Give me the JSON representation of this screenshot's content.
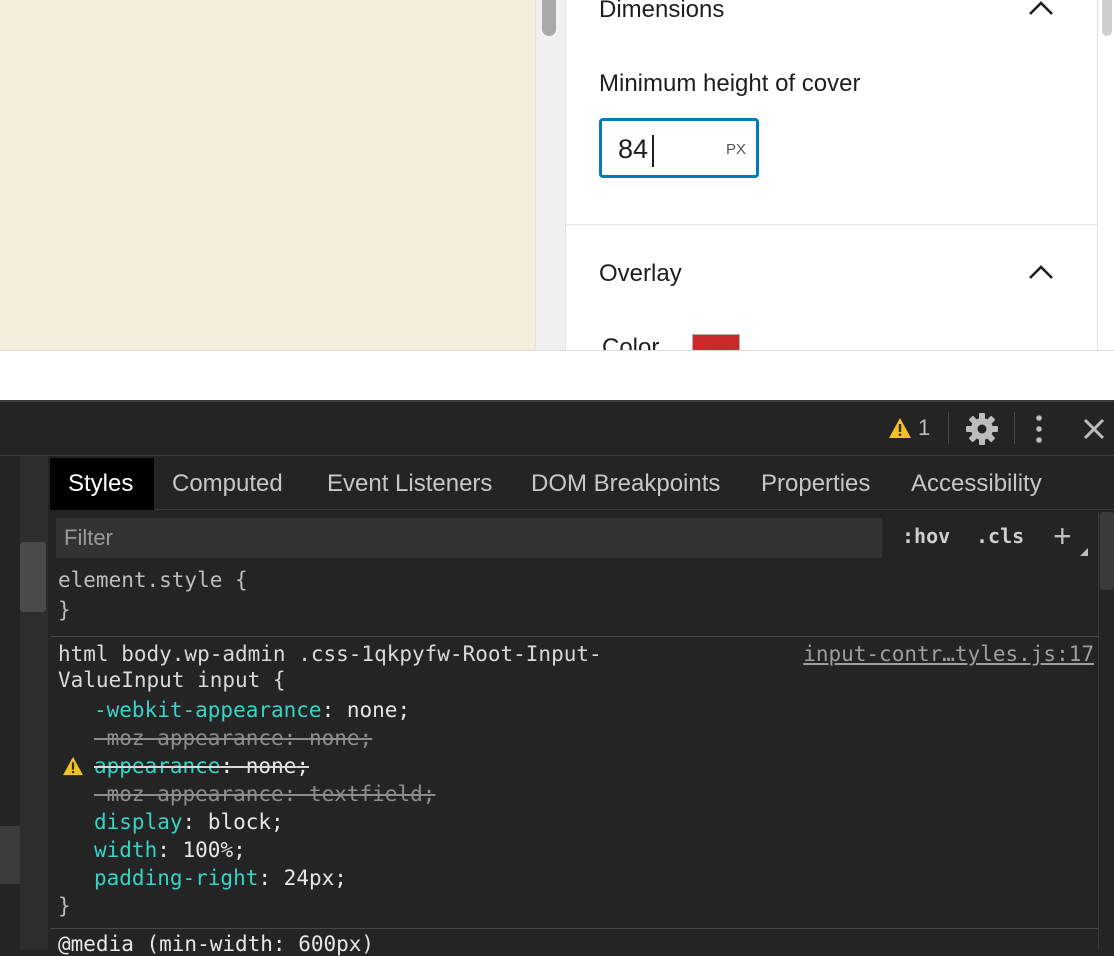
{
  "sidebar_panel": {
    "dimensions": {
      "title": "Dimensions",
      "min_height_label": "Minimum height of cover",
      "min_height_value": "84",
      "min_height_unit": "PX"
    },
    "overlay": {
      "title": "Overlay",
      "color_label": "Color",
      "color_value": "#cc2a2a"
    }
  },
  "devtools": {
    "toolbar": {
      "warning_count": "1"
    },
    "tabs": [
      {
        "label": "Styles",
        "active": true
      },
      {
        "label": "Computed",
        "active": false
      },
      {
        "label": "Event Listeners",
        "active": false
      },
      {
        "label": "DOM Breakpoints",
        "active": false
      },
      {
        "label": "Properties",
        "active": false
      },
      {
        "label": "Accessibility",
        "active": false
      }
    ],
    "filter": {
      "placeholder": "Filter",
      "hov_label": ":hov",
      "cls_label": ".cls",
      "add_label": "+"
    },
    "element_style": {
      "open": "element.style {",
      "close": "}"
    },
    "rule": {
      "selector_line1": "html body.wp-admin .css-1qkpyfw-Root-Input-",
      "selector_line2": "ValueInput input {",
      "source": "input-contr…tyles.js:17",
      "declarations": [
        {
          "prop": "-webkit-appearance",
          "value": "none",
          "struck": false
        },
        {
          "prop": "-moz-appearance",
          "value": "none",
          "struck": true
        },
        {
          "prop": "appearance",
          "value": "none",
          "struck": true,
          "warning": true
        },
        {
          "prop": "-moz-appearance",
          "value": "textfield",
          "struck": true
        },
        {
          "prop": "display",
          "value": "block",
          "struck": false
        },
        {
          "prop": "width",
          "value": "100%",
          "struck": false
        },
        {
          "prop": "padding-right",
          "value": "24px",
          "struck": false
        }
      ],
      "close": "}"
    },
    "next_rule_partial": "@media (min-width: 600px)"
  },
  "colors": {
    "accent": "#007cba",
    "devtools_bg": "#242424",
    "property": "#35d4c7"
  }
}
